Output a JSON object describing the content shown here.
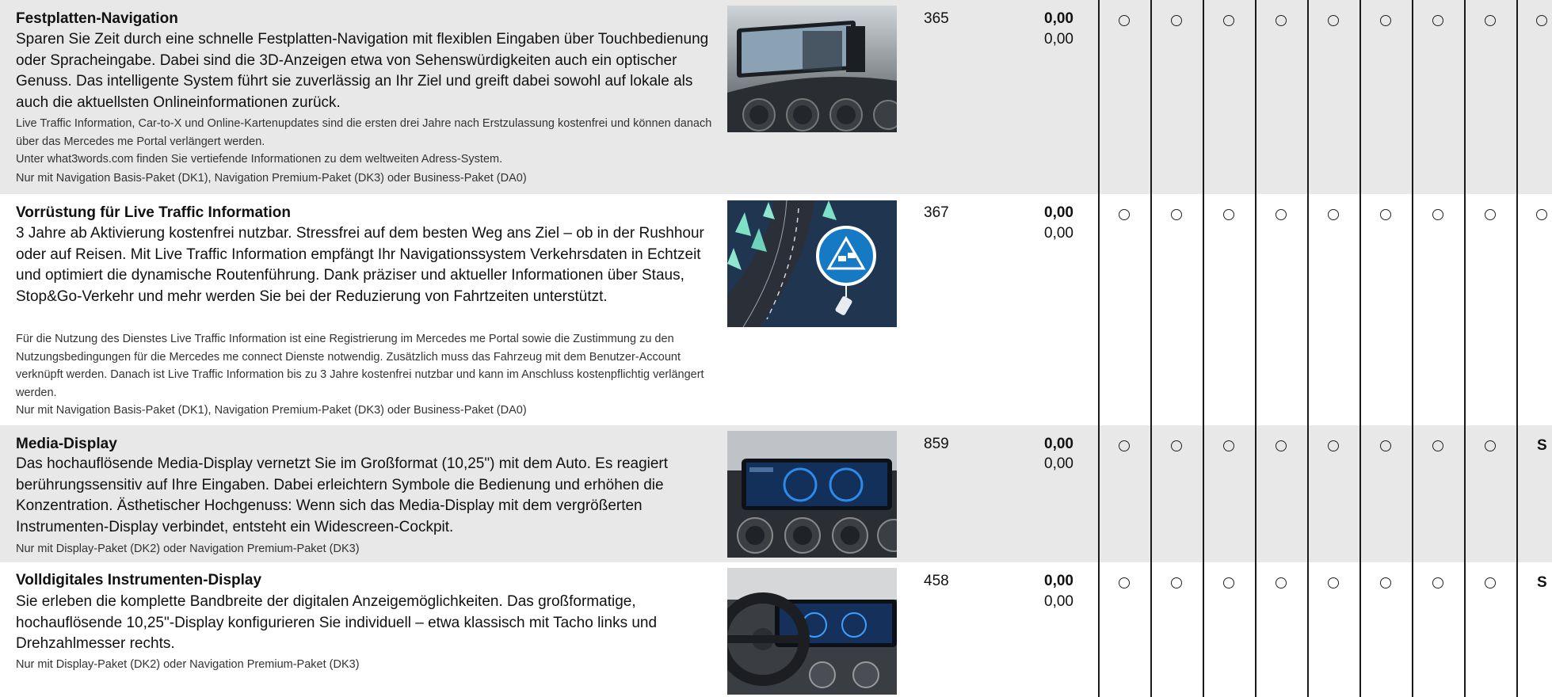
{
  "rows": [
    {
      "title": "Festplatten-Navigation",
      "desc": "Sparen Sie Zeit durch eine schnelle Festplatten-Navigation mit flexiblen Eingaben über Touchbedienung oder Spracheingabe. Dabei sind die 3D-Anzeigen etwa von Sehenswürdigkeiten auch ein optischer Genuss. Das intelligente System führt sie zuverlässig an Ihr Ziel und greift dabei sowohl auf lokale als auch die aktuellsten Onlineinformationen zurück.",
      "notes": [
        "Live Traffic Information, Car-to-X und Online-Kartenupdates sind die ersten drei Jahre nach Erstzulassung kostenfrei und können danach über das Mercedes me Portal verlängert werden.",
        "Unter what3words.com finden Sie vertiefende Informationen zu dem weltweiten Adress-System.",
        "Nur mit Navigation Basis-Paket (DK1), Navigation Premium-Paket (DK3) oder Business-Paket (DA0)"
      ],
      "code": "365",
      "price_bold": "0,00",
      "price": "0,00",
      "cells": [
        "○",
        "○",
        "○",
        "○",
        "○",
        "○",
        "○",
        "○",
        "○"
      ],
      "image": "navigation-display-photo"
    },
    {
      "title": "Vorrüstung für Live Traffic Information",
      "desc": "3 Jahre ab Aktivierung kostenfrei nutzbar. Stressfrei auf dem besten Weg ans Ziel – ob in der Rushhour oder auf Reisen. Mit Live Traffic Information empfängt Ihr Navigationssystem Verkehrsdaten in Echtzeit und optimiert die dynamische Routenführung. Dank präziser und aktueller Informationen über Staus, Stop&Go-Verkehr und mehr werden Sie bei der Reduzierung von Fahrtzeiten unterstützt.",
      "notes": [
        "Für die Nutzung des Dienstes Live Traffic Information ist eine Registrierung im Mercedes me Portal sowie die Zustimmung zu den Nutzungsbedingungen für die Mercedes me connect Dienste notwendig. Zusätzlich muss das Fahrzeug mit dem Benutzer-Account verknüpft werden. Danach ist Live Traffic Information bis zu 3 Jahre kostenfrei nutzbar und kann im Anschluss kostenpflichtig verlängert werden.",
        "Nur mit Navigation Basis-Paket (DK1), Navigation Premium-Paket (DK3) oder Business-Paket (DA0)"
      ],
      "code": "367",
      "price_bold": "0,00",
      "price": "0,00",
      "cells": [
        "○",
        "○",
        "○",
        "○",
        "○",
        "○",
        "○",
        "○",
        "○"
      ],
      "image": "traffic-illustration"
    },
    {
      "title": "Media-Display",
      "desc": "Das hochauflösende Media-Display vernetzt Sie im Großformat (10,25\") mit dem Auto. Es reagiert berührungssensitiv auf Ihre Eingaben. Dabei erleichtern Symbole die Bedienung und erhöhen die Konzentration. Ästhetischer Hochgenuss: Wenn sich das Media-Display mit dem vergrößerten Instrumenten-Display verbindet, entsteht ein Widescreen-Cockpit.",
      "notes": [
        "Nur mit Display-Paket (DK2) oder Navigation Premium-Paket (DK3)"
      ],
      "code": "859",
      "price_bold": "0,00",
      "price": "0,00",
      "cells": [
        "○",
        "○",
        "○",
        "○",
        "○",
        "○",
        "○",
        "○",
        "S"
      ],
      "image": "media-display-photo"
    },
    {
      "title": "Volldigitales Instrumenten-Display",
      "desc": "Sie erleben die komplette Bandbreite der digitalen Anzeigemöglichkeiten. Das großformatige, hochauflösende 10,25\"-Display konfigurieren Sie individuell – etwa klassisch mit Tacho links und Drehzahlmesser rechts.",
      "notes": [
        "Nur mit Display-Paket (DK2) oder Navigation Premium-Paket (DK3)"
      ],
      "code": "458",
      "price_bold": "0,00",
      "price": "0,00",
      "cells": [
        "○",
        "○",
        "○",
        "○",
        "○",
        "○",
        "○",
        "○",
        "S"
      ],
      "image": "cockpit-photo"
    }
  ]
}
